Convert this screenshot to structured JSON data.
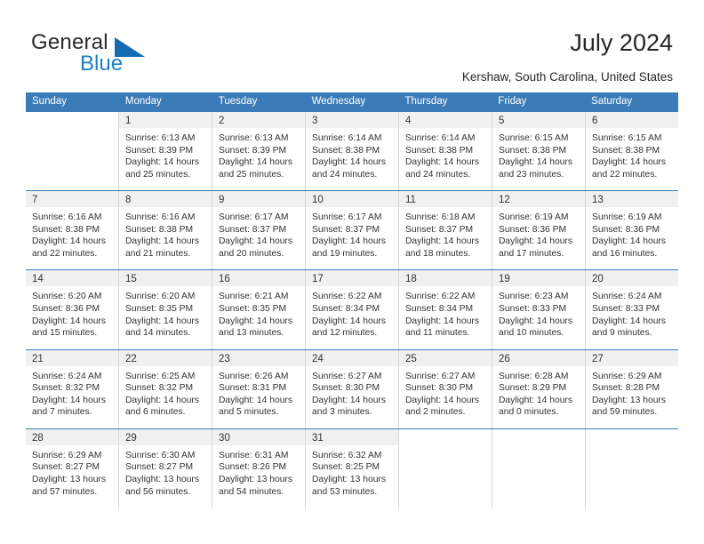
{
  "brand": {
    "name_part1": "General",
    "name_part2": "Blue",
    "accent_color": "#1f7fc4",
    "triangle_color": "#156bb1"
  },
  "header": {
    "title": "July 2024",
    "subtitle": "Kershaw, South Carolina, United States"
  },
  "calendar": {
    "header_color": "#3b7cb8",
    "daynum_band_color": "#f0f0f0",
    "weekdays": [
      "Sunday",
      "Monday",
      "Tuesday",
      "Wednesday",
      "Thursday",
      "Friday",
      "Saturday"
    ],
    "weeks": [
      [
        {
          "day": "",
          "sunrise": "",
          "sunset": "",
          "daylight1": "",
          "daylight2": ""
        },
        {
          "day": "1",
          "sunrise": "Sunrise: 6:13 AM",
          "sunset": "Sunset: 8:39 PM",
          "daylight1": "Daylight: 14 hours",
          "daylight2": "and 25 minutes."
        },
        {
          "day": "2",
          "sunrise": "Sunrise: 6:13 AM",
          "sunset": "Sunset: 8:39 PM",
          "daylight1": "Daylight: 14 hours",
          "daylight2": "and 25 minutes."
        },
        {
          "day": "3",
          "sunrise": "Sunrise: 6:14 AM",
          "sunset": "Sunset: 8:38 PM",
          "daylight1": "Daylight: 14 hours",
          "daylight2": "and 24 minutes."
        },
        {
          "day": "4",
          "sunrise": "Sunrise: 6:14 AM",
          "sunset": "Sunset: 8:38 PM",
          "daylight1": "Daylight: 14 hours",
          "daylight2": "and 24 minutes."
        },
        {
          "day": "5",
          "sunrise": "Sunrise: 6:15 AM",
          "sunset": "Sunset: 8:38 PM",
          "daylight1": "Daylight: 14 hours",
          "daylight2": "and 23 minutes."
        },
        {
          "day": "6",
          "sunrise": "Sunrise: 6:15 AM",
          "sunset": "Sunset: 8:38 PM",
          "daylight1": "Daylight: 14 hours",
          "daylight2": "and 22 minutes."
        }
      ],
      [
        {
          "day": "7",
          "sunrise": "Sunrise: 6:16 AM",
          "sunset": "Sunset: 8:38 PM",
          "daylight1": "Daylight: 14 hours",
          "daylight2": "and 22 minutes."
        },
        {
          "day": "8",
          "sunrise": "Sunrise: 6:16 AM",
          "sunset": "Sunset: 8:38 PM",
          "daylight1": "Daylight: 14 hours",
          "daylight2": "and 21 minutes."
        },
        {
          "day": "9",
          "sunrise": "Sunrise: 6:17 AM",
          "sunset": "Sunset: 8:37 PM",
          "daylight1": "Daylight: 14 hours",
          "daylight2": "and 20 minutes."
        },
        {
          "day": "10",
          "sunrise": "Sunrise: 6:17 AM",
          "sunset": "Sunset: 8:37 PM",
          "daylight1": "Daylight: 14 hours",
          "daylight2": "and 19 minutes."
        },
        {
          "day": "11",
          "sunrise": "Sunrise: 6:18 AM",
          "sunset": "Sunset: 8:37 PM",
          "daylight1": "Daylight: 14 hours",
          "daylight2": "and 18 minutes."
        },
        {
          "day": "12",
          "sunrise": "Sunrise: 6:19 AM",
          "sunset": "Sunset: 8:36 PM",
          "daylight1": "Daylight: 14 hours",
          "daylight2": "and 17 minutes."
        },
        {
          "day": "13",
          "sunrise": "Sunrise: 6:19 AM",
          "sunset": "Sunset: 8:36 PM",
          "daylight1": "Daylight: 14 hours",
          "daylight2": "and 16 minutes."
        }
      ],
      [
        {
          "day": "14",
          "sunrise": "Sunrise: 6:20 AM",
          "sunset": "Sunset: 8:36 PM",
          "daylight1": "Daylight: 14 hours",
          "daylight2": "and 15 minutes."
        },
        {
          "day": "15",
          "sunrise": "Sunrise: 6:20 AM",
          "sunset": "Sunset: 8:35 PM",
          "daylight1": "Daylight: 14 hours",
          "daylight2": "and 14 minutes."
        },
        {
          "day": "16",
          "sunrise": "Sunrise: 6:21 AM",
          "sunset": "Sunset: 8:35 PM",
          "daylight1": "Daylight: 14 hours",
          "daylight2": "and 13 minutes."
        },
        {
          "day": "17",
          "sunrise": "Sunrise: 6:22 AM",
          "sunset": "Sunset: 8:34 PM",
          "daylight1": "Daylight: 14 hours",
          "daylight2": "and 12 minutes."
        },
        {
          "day": "18",
          "sunrise": "Sunrise: 6:22 AM",
          "sunset": "Sunset: 8:34 PM",
          "daylight1": "Daylight: 14 hours",
          "daylight2": "and 11 minutes."
        },
        {
          "day": "19",
          "sunrise": "Sunrise: 6:23 AM",
          "sunset": "Sunset: 8:33 PM",
          "daylight1": "Daylight: 14 hours",
          "daylight2": "and 10 minutes."
        },
        {
          "day": "20",
          "sunrise": "Sunrise: 6:24 AM",
          "sunset": "Sunset: 8:33 PM",
          "daylight1": "Daylight: 14 hours",
          "daylight2": "and 9 minutes."
        }
      ],
      [
        {
          "day": "21",
          "sunrise": "Sunrise: 6:24 AM",
          "sunset": "Sunset: 8:32 PM",
          "daylight1": "Daylight: 14 hours",
          "daylight2": "and 7 minutes."
        },
        {
          "day": "22",
          "sunrise": "Sunrise: 6:25 AM",
          "sunset": "Sunset: 8:32 PM",
          "daylight1": "Daylight: 14 hours",
          "daylight2": "and 6 minutes."
        },
        {
          "day": "23",
          "sunrise": "Sunrise: 6:26 AM",
          "sunset": "Sunset: 8:31 PM",
          "daylight1": "Daylight: 14 hours",
          "daylight2": "and 5 minutes."
        },
        {
          "day": "24",
          "sunrise": "Sunrise: 6:27 AM",
          "sunset": "Sunset: 8:30 PM",
          "daylight1": "Daylight: 14 hours",
          "daylight2": "and 3 minutes."
        },
        {
          "day": "25",
          "sunrise": "Sunrise: 6:27 AM",
          "sunset": "Sunset: 8:30 PM",
          "daylight1": "Daylight: 14 hours",
          "daylight2": "and 2 minutes."
        },
        {
          "day": "26",
          "sunrise": "Sunrise: 6:28 AM",
          "sunset": "Sunset: 8:29 PM",
          "daylight1": "Daylight: 14 hours",
          "daylight2": "and 0 minutes."
        },
        {
          "day": "27",
          "sunrise": "Sunrise: 6:29 AM",
          "sunset": "Sunset: 8:28 PM",
          "daylight1": "Daylight: 13 hours",
          "daylight2": "and 59 minutes."
        }
      ],
      [
        {
          "day": "28",
          "sunrise": "Sunrise: 6:29 AM",
          "sunset": "Sunset: 8:27 PM",
          "daylight1": "Daylight: 13 hours",
          "daylight2": "and 57 minutes."
        },
        {
          "day": "29",
          "sunrise": "Sunrise: 6:30 AM",
          "sunset": "Sunset: 8:27 PM",
          "daylight1": "Daylight: 13 hours",
          "daylight2": "and 56 minutes."
        },
        {
          "day": "30",
          "sunrise": "Sunrise: 6:31 AM",
          "sunset": "Sunset: 8:26 PM",
          "daylight1": "Daylight: 13 hours",
          "daylight2": "and 54 minutes."
        },
        {
          "day": "31",
          "sunrise": "Sunrise: 6:32 AM",
          "sunset": "Sunset: 8:25 PM",
          "daylight1": "Daylight: 13 hours",
          "daylight2": "and 53 minutes."
        },
        {
          "day": "",
          "sunrise": "",
          "sunset": "",
          "daylight1": "",
          "daylight2": ""
        },
        {
          "day": "",
          "sunrise": "",
          "sunset": "",
          "daylight1": "",
          "daylight2": ""
        },
        {
          "day": "",
          "sunrise": "",
          "sunset": "",
          "daylight1": "",
          "daylight2": ""
        }
      ]
    ]
  }
}
